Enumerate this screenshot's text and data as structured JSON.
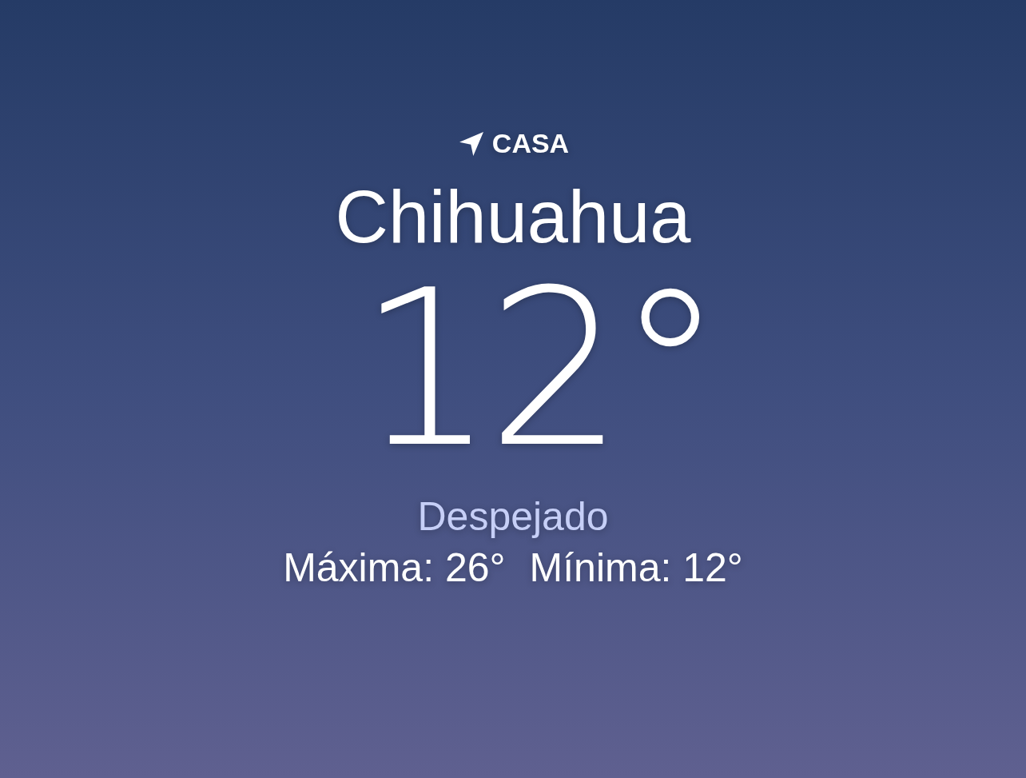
{
  "location": {
    "label": "CASA",
    "current": true
  },
  "city": "Chihuahua",
  "temperature": "12°",
  "condition": "Despejado",
  "high": "Máxima: 26°",
  "low": "Mínima: 12°"
}
